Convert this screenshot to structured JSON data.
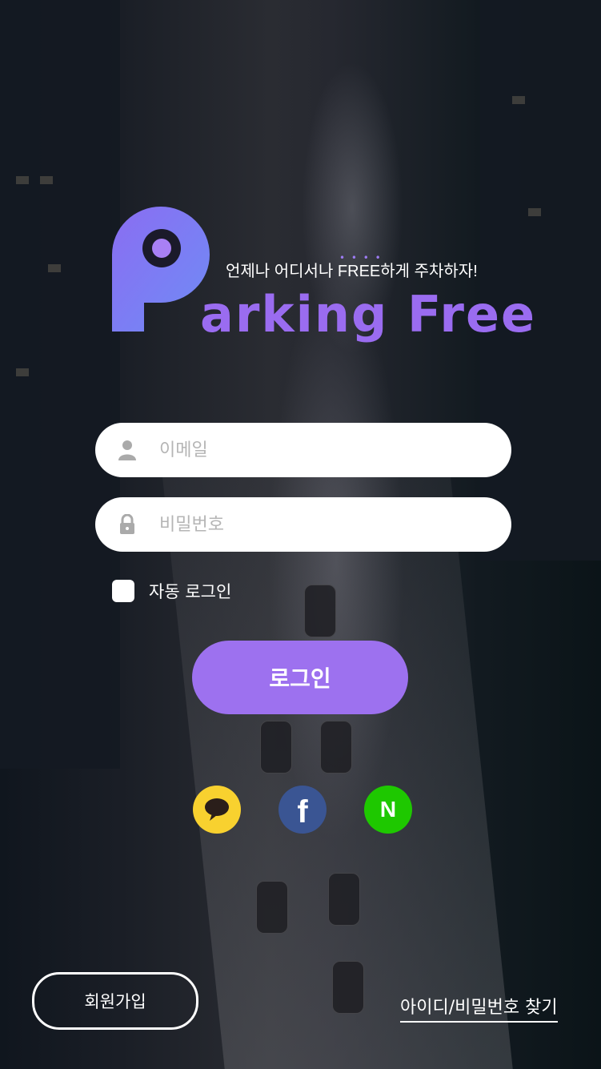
{
  "brand": {
    "tagline": "언제나 어디서나 FREE하게 주차하자!",
    "wordmark": "arking Free",
    "logo_letter": "P",
    "accent": "#9a6cf0"
  },
  "form": {
    "email_placeholder": "이메일",
    "password_placeholder": "비밀번호",
    "auto_login_label": "자동 로그인",
    "login_button": "로그인"
  },
  "social": {
    "kakao_color": "#f8d12f",
    "facebook_color": "#3a5593",
    "naver_color": "#1ec800",
    "naver_letter": "N",
    "facebook_letter": "f"
  },
  "footer": {
    "signup_button": "회원가입",
    "find_account_link": "아이디/비밀번호 찾기"
  }
}
